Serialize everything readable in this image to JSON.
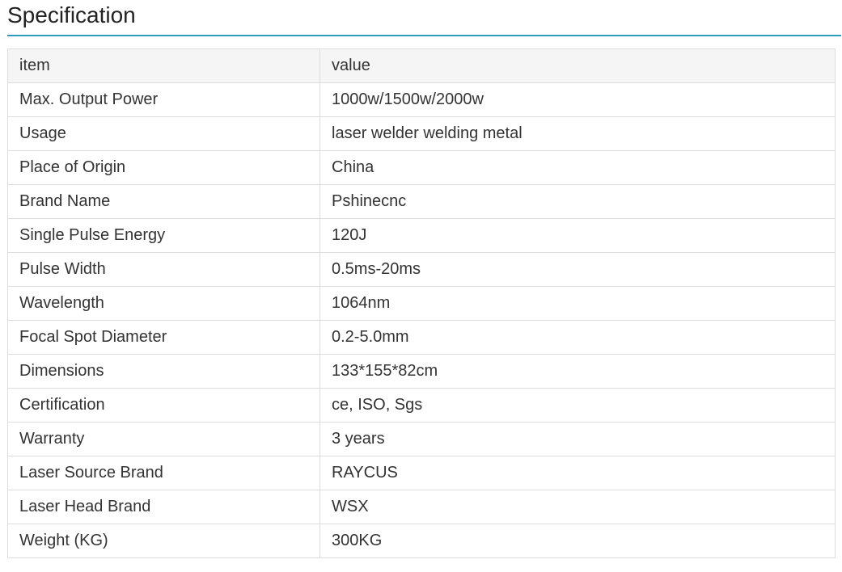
{
  "heading": {
    "title": "Specification",
    "accent_color": "#2a9bc1"
  },
  "table": {
    "header": {
      "item": "item",
      "value": "value"
    },
    "rows": [
      {
        "item": "Max. Output Power",
        "value": "1000w/1500w/2000w"
      },
      {
        "item": "Usage",
        "value": "laser welder welding metal"
      },
      {
        "item": "Place of Origin",
        "value": "China"
      },
      {
        "item": "Brand Name",
        "value": "Pshinecnc"
      },
      {
        "item": "Single Pulse Energy",
        "value": "120J"
      },
      {
        "item": "Pulse Width",
        "value": "0.5ms-20ms"
      },
      {
        "item": "Wavelength",
        "value": "1064nm"
      },
      {
        "item": "Focal Spot Diameter",
        "value": "0.2-5.0mm"
      },
      {
        "item": "Dimensions",
        "value": "133*155*82cm"
      },
      {
        "item": "Certification",
        "value": "ce, ISO, Sgs"
      },
      {
        "item": "Warranty",
        "value": "3 years"
      },
      {
        "item": "Laser Source Brand",
        "value": "RAYCUS"
      },
      {
        "item": "Laser Head Brand",
        "value": "WSX"
      },
      {
        "item": "Weight (KG)",
        "value": "300KG"
      }
    ]
  }
}
